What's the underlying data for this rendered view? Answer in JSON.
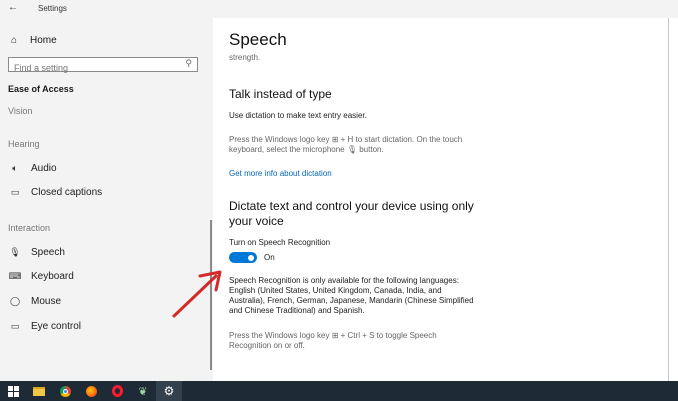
{
  "window": {
    "title": "Settings",
    "back_glyph": "←"
  },
  "sidebar": {
    "home": {
      "icon": "home-icon",
      "label": "Home"
    },
    "search": {
      "placeholder": "Find a setting",
      "icon": "search-icon"
    },
    "section_title": "Ease of Access",
    "categories": {
      "vision": "Vision",
      "hearing": "Hearing",
      "interaction": "Interaction"
    },
    "items": [
      {
        "id": "audio",
        "icon": "speaker-icon",
        "label": "Audio"
      },
      {
        "id": "closed-captions",
        "icon": "captions-icon",
        "label": "Closed captions"
      },
      {
        "id": "speech",
        "icon": "microphone-icon",
        "label": "Speech"
      },
      {
        "id": "keyboard",
        "icon": "keyboard-icon",
        "label": "Keyboard"
      },
      {
        "id": "mouse",
        "icon": "mouse-icon",
        "label": "Mouse"
      },
      {
        "id": "eye-control",
        "icon": "eye-control-icon",
        "label": "Eye control"
      }
    ]
  },
  "main": {
    "title": "Speech",
    "top_snippet": "strength.",
    "talk": {
      "heading": "Talk instead of type",
      "description": "Use dictation to make text entry easier.",
      "instructions_line1": "Press the Windows logo key ⊞ + H to start dictation.  On the touch",
      "instructions_line2": "keyboard, select the microphone 🎙 button.",
      "link": "Get more info about dictation"
    },
    "dictate": {
      "heading_line1": "Dictate text and control your device using only",
      "heading_line2": "your voice",
      "toggle_label": "Turn on Speech Recognition",
      "toggle_state": "On",
      "availability_line1": "Speech Recognition is only available for the following languages:",
      "availability_line2": "English (United States, United Kingdom, Canada, India, and",
      "availability_line3": "Australia), French, German, Japanese, Mandarin (Chinese Simplified",
      "availability_line4": "and Chinese Traditional) and Spanish.",
      "shortcut_line1": "Press the Windows logo key ⊞ + Ctrl + S to toggle Speech",
      "shortcut_line2": "Recognition on or off."
    }
  },
  "colors": {
    "accent": "#0078d7",
    "link": "#0067b8",
    "arrow": "#d42a2a",
    "taskbar": "#1e2a36",
    "sidebar": "#f3f3f3"
  },
  "taskbar": {
    "icons": [
      "windows-start-icon",
      "file-explorer-icon",
      "chrome-icon",
      "firefox-icon",
      "opera-icon",
      "leaf-app-icon",
      "settings-gear-icon"
    ]
  }
}
